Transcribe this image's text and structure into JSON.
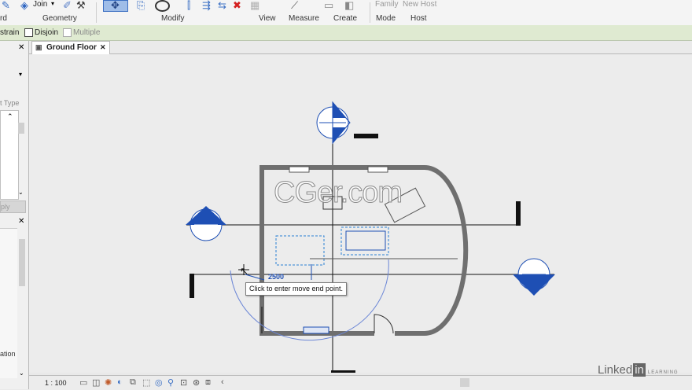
{
  "ribbon": {
    "groups": [
      {
        "name": "Geometry",
        "label": "Geometry"
      },
      {
        "name": "Modify",
        "label": "Modify"
      },
      {
        "name": "View",
        "label": "View"
      },
      {
        "name": "Measure",
        "label": "Measure"
      },
      {
        "name": "Create",
        "label": "Create"
      },
      {
        "name": "Mode",
        "label": "Mode"
      },
      {
        "name": "Host",
        "label": "Host"
      }
    ],
    "join_label": "Join",
    "clip_label": "rd",
    "family_label": "Family",
    "new_host_label": "New Host"
  },
  "options_bar": {
    "constrain_label": "strain",
    "disjoin_label": "Disjoin",
    "multiple_label": "Multiple"
  },
  "left_panel": {
    "type_label": "t Type",
    "apply_label": "ply",
    "section_label": "ation"
  },
  "view_tab": {
    "label": "Ground Floor"
  },
  "tooltip": {
    "text": "Click to enter move end point."
  },
  "dimension": {
    "value": "2500"
  },
  "status_bar": {
    "scale": "1 : 100"
  },
  "watermark": {
    "text": "CGer.com"
  },
  "branding": {
    "linked": "Linked",
    "in": "in",
    "learning": "LEARNING"
  },
  "colors": {
    "accent": "#1e4fb4",
    "wall": "#777777",
    "highlight": "#2a7fd4"
  }
}
